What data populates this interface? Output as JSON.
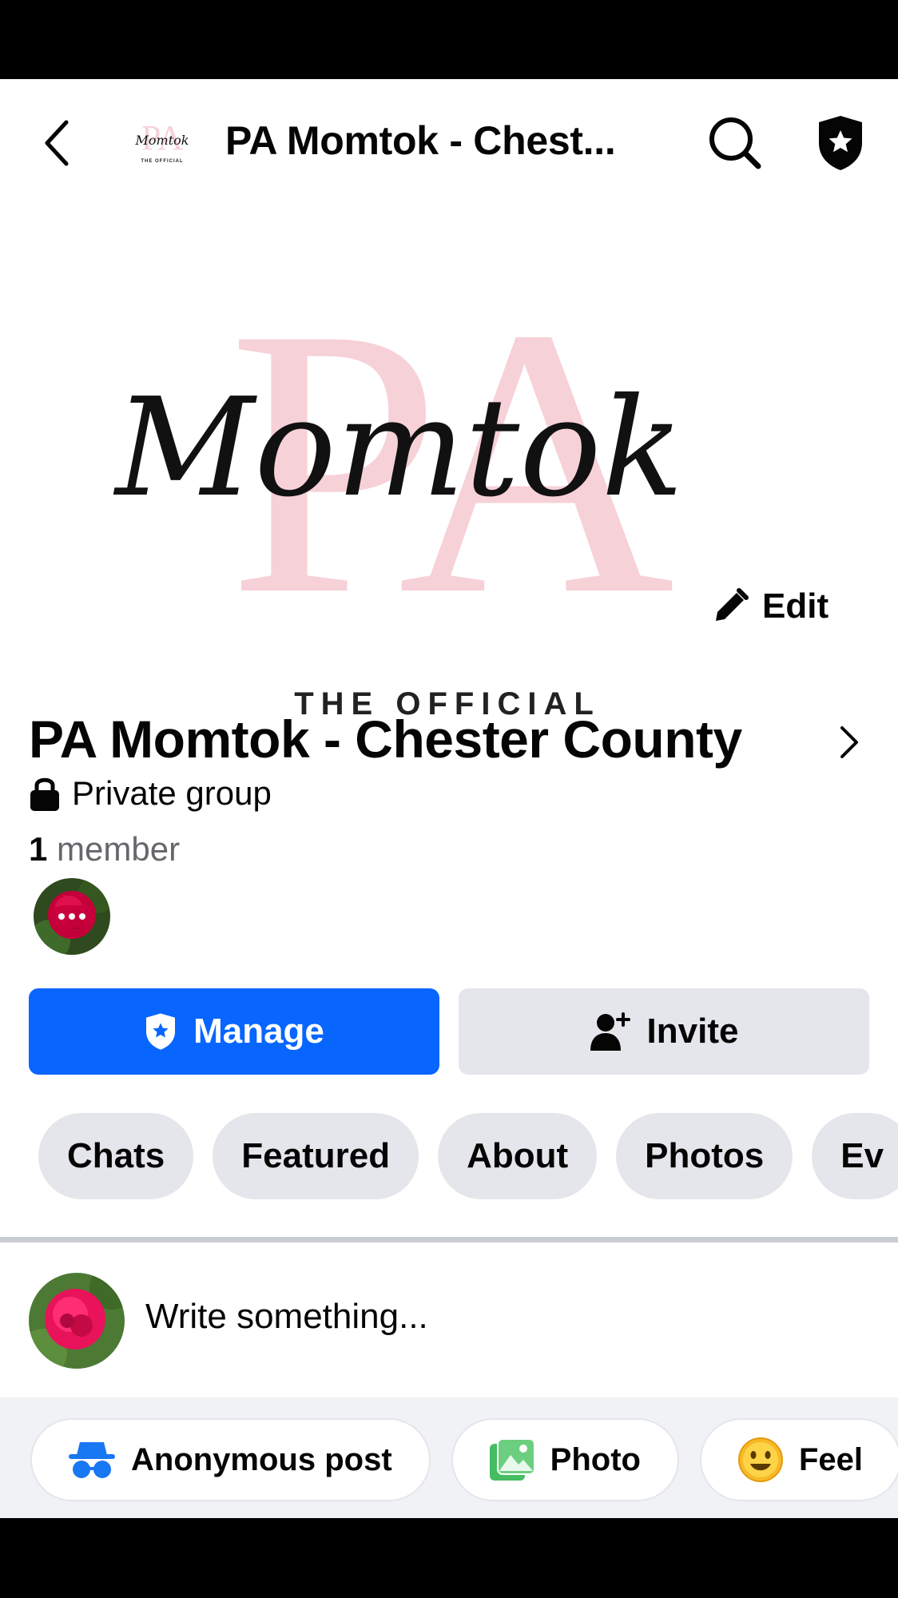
{
  "nav": {
    "title": "PA Momtok - Chest...",
    "thumb_script": "Momtok",
    "thumb_caption": "THE OFFICIAL"
  },
  "cover": {
    "monogram": "PA",
    "script": "Momtok",
    "caption": "THE OFFICIAL",
    "edit_label": "Edit",
    "accent_pink": "#f7d1d8"
  },
  "group": {
    "name": "PA Momtok - Chester County",
    "privacy": "Private group",
    "member_count": "1",
    "member_label": "member"
  },
  "actions": {
    "manage": "Manage",
    "invite": "Invite",
    "brand_blue": "#0866ff"
  },
  "tabs": [
    {
      "label": "Chats"
    },
    {
      "label": "Featured"
    },
    {
      "label": "About"
    },
    {
      "label": "Photos"
    },
    {
      "label": "Ev"
    }
  ],
  "composer": {
    "placeholder": "Write something...",
    "chips": [
      {
        "label": "Anonymous post",
        "icon": "incognito-icon"
      },
      {
        "label": "Photo",
        "icon": "photo-icon"
      },
      {
        "label": "Feel",
        "icon": "smiley-icon"
      }
    ]
  }
}
